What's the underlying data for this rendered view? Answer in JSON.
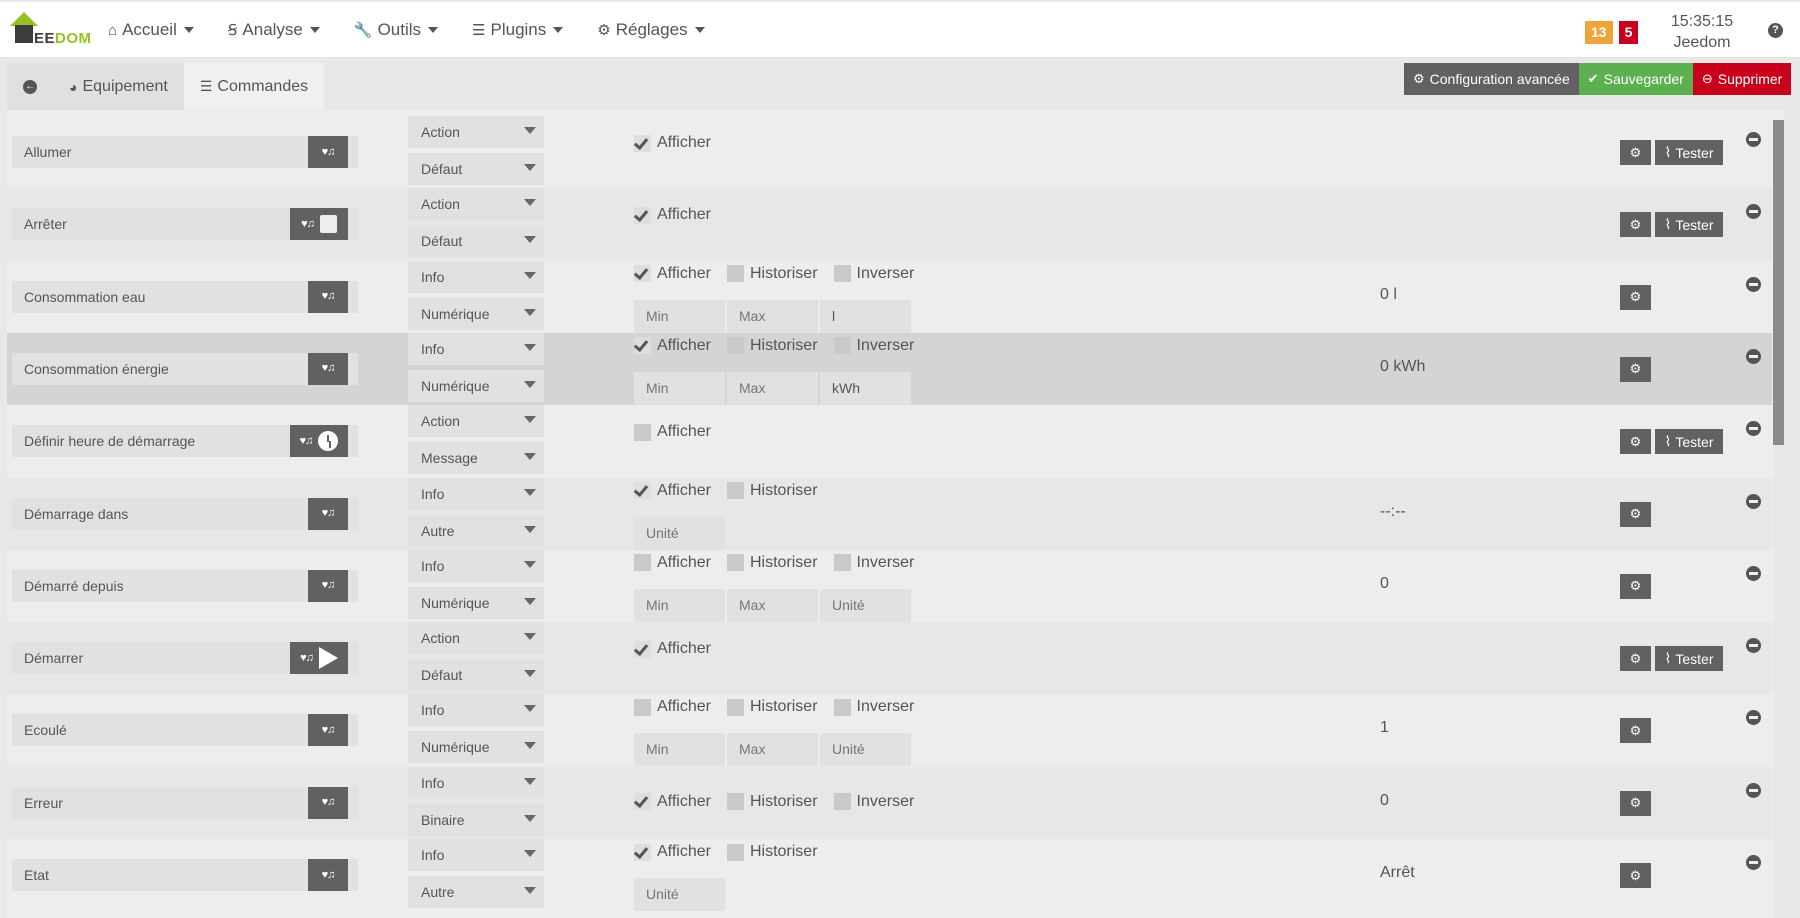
{
  "header": {
    "logo_text_dark": "EE",
    "logo_text_green": "DOM",
    "nav": [
      {
        "label": "Accueil",
        "icon": "home-icon",
        "glyph": "⌂"
      },
      {
        "label": "Analyse",
        "icon": "stethoscope-icon",
        "glyph": "Ꞩ"
      },
      {
        "label": "Outils",
        "icon": "wrench-icon",
        "glyph": "🔧"
      },
      {
        "label": "Plugins",
        "icon": "tasks-icon",
        "glyph": "☰"
      },
      {
        "label": "Réglages",
        "icon": "cog-icon",
        "glyph": "⚙"
      }
    ],
    "badges": [
      {
        "value": "13",
        "color": "#f0a33a"
      },
      {
        "value": "5",
        "color": "#c9001b"
      }
    ],
    "time": "15:35:15",
    "user": "Jeedom",
    "help_glyph": "?"
  },
  "tabs": {
    "back_glyph": "←",
    "equipement": "Equipement",
    "commandes": "Commandes"
  },
  "actions": {
    "advanced": "Configuration avancée",
    "save": "Sauvegarder",
    "delete": "Supprimer"
  },
  "row_ui": {
    "afficher": "Afficher",
    "historiser": "Historiser",
    "inverser": "Inverser",
    "min_placeholder": "Min",
    "max_placeholder": "Max",
    "unit_placeholder": "Unité",
    "tester": "Tester",
    "widget_glyph": "♥♫",
    "gear_glyph": "⚙",
    "rss_glyph": "⌇"
  },
  "commands": [
    {
      "name": "Allumer",
      "type": "Action",
      "subtype": "Défaut",
      "extra": "",
      "afficher": true,
      "historiser": null,
      "inverser": null,
      "inputs": "none",
      "value": "",
      "tester": true
    },
    {
      "name": "Arrêter",
      "type": "Action",
      "subtype": "Défaut",
      "extra": "square",
      "afficher": true,
      "historiser": null,
      "inverser": null,
      "inputs": "none",
      "value": "",
      "tester": true
    },
    {
      "name": "Consommation eau",
      "type": "Info",
      "subtype": "Numérique",
      "extra": "",
      "afficher": true,
      "historiser": false,
      "inverser": false,
      "inputs": "minmaxunit",
      "unit": "l",
      "value": "0 l",
      "tester": false
    },
    {
      "name": "Consommation énergie",
      "type": "Info",
      "subtype": "Numérique",
      "extra": "",
      "afficher": true,
      "historiser": false,
      "inverser": false,
      "inputs": "minmaxunit",
      "unit": "kWh",
      "value": "0 kWh",
      "tester": false,
      "highlight": true
    },
    {
      "name": "Définir heure de démarrage",
      "type": "Action",
      "subtype": "Message",
      "extra": "clock",
      "afficher": false,
      "historiser": null,
      "inverser": null,
      "inputs": "none",
      "value": "",
      "tester": true
    },
    {
      "name": "Démarrage dans",
      "type": "Info",
      "subtype": "Autre",
      "extra": "",
      "afficher": true,
      "historiser": false,
      "inverser": null,
      "inputs": "unit",
      "unit": "",
      "value": "--:--",
      "tester": false
    },
    {
      "name": "Démarré depuis",
      "type": "Info",
      "subtype": "Numérique",
      "extra": "",
      "afficher": false,
      "historiser": false,
      "inverser": false,
      "inputs": "minmaxunit",
      "unit": "",
      "value": "0",
      "tester": false
    },
    {
      "name": "Démarrer",
      "type": "Action",
      "subtype": "Défaut",
      "extra": "play",
      "afficher": true,
      "historiser": null,
      "inverser": null,
      "inputs": "none",
      "value": "",
      "tester": true
    },
    {
      "name": "Ecoulé",
      "type": "Info",
      "subtype": "Numérique",
      "extra": "",
      "afficher": false,
      "historiser": false,
      "inverser": false,
      "inputs": "minmaxunit",
      "unit": "",
      "value": "1",
      "tester": false
    },
    {
      "name": "Erreur",
      "type": "Info",
      "subtype": "Binaire",
      "extra": "",
      "afficher": true,
      "historiser": false,
      "inverser": false,
      "inputs": "none",
      "value": "0",
      "tester": false
    },
    {
      "name": "Etat",
      "type": "Info",
      "subtype": "Autre",
      "extra": "",
      "afficher": true,
      "historiser": false,
      "inverser": null,
      "inputs": "unit",
      "unit": "",
      "value": "Arrêt",
      "tester": false
    }
  ]
}
